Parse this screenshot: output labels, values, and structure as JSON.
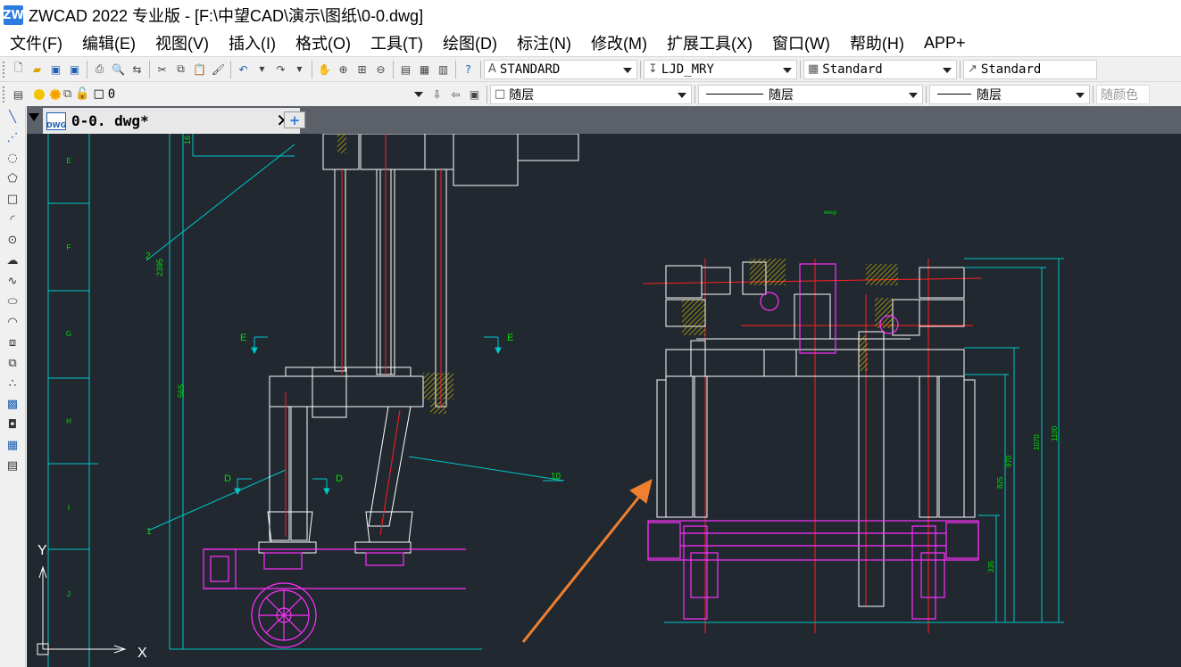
{
  "app": {
    "logo": "ZW",
    "title": "ZWCAD 2022 专业版 - [F:\\中望CAD\\演示\\图纸\\0-0.dwg]"
  },
  "menu": [
    "文件(F)",
    "编辑(E)",
    "视图(V)",
    "插入(I)",
    "格式(O)",
    "工具(T)",
    "绘图(D)",
    "标注(N)",
    "修改(M)",
    "扩展工具(X)",
    "窗口(W)",
    "帮助(H)",
    "APP+"
  ],
  "toolbar1": {
    "text_style": "STANDARD",
    "dim_style": "LJD_MRY",
    "table_style": "Standard",
    "multileader_style": "Standard"
  },
  "toolbar2": {
    "layer": "0",
    "color": "随层",
    "linetype": "随层",
    "lineweight": "随层",
    "plotstyle": "随颜色"
  },
  "tab": {
    "label": "0-0. dwg*",
    "close": "✕",
    "new": "+"
  },
  "drawing": {
    "zone_labels": [
      "E",
      "F",
      "G",
      "H",
      "I",
      "J"
    ],
    "dims_left": [
      "16",
      "2395",
      "565"
    ],
    "dims_right": [
      "1100",
      "1070",
      "970",
      "825",
      "335"
    ],
    "section_labels": [
      "E",
      "E",
      "D",
      "D"
    ],
    "balloons": [
      "2",
      "1",
      "10"
    ],
    "ucs_y": "Y",
    "ucs_x": "X",
    "note": "wesp"
  },
  "colors": {
    "canvas": "#212830",
    "geometry": "#ffffff",
    "dimension": "#00d0d0",
    "center": "#ff2020",
    "hatch": "#e0c800",
    "wheel": "#ff30ff",
    "text": "#00e000",
    "arrow": "#f08030"
  }
}
